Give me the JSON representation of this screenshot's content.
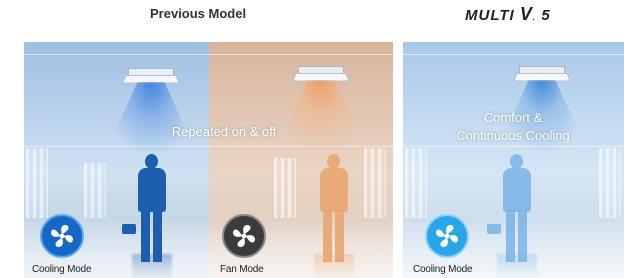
{
  "header": {
    "previous_label": "Previous Model",
    "brand_text": "MULTI",
    "brand_v": "V",
    "brand_num": "5"
  },
  "previous_panel": {
    "overlay_text": "Repeated on & off",
    "modes": [
      {
        "label": "Cooling Mode",
        "icon": "fan-icon",
        "color": "#1767c6"
      },
      {
        "label": "Fan Mode",
        "icon": "fan-icon",
        "color": "#3b3b3b"
      }
    ]
  },
  "new_panel": {
    "overlay_line1": "Comfort &",
    "overlay_line2": "Continuous Cooling",
    "mode": {
      "label": "Cooling Mode",
      "icon": "fan-icon",
      "color": "#2aa5e8"
    }
  },
  "colors": {
    "cool_tint": "#9fbfe4",
    "warm_tint": "#d7b49b",
    "person_cool": "#1d5fae",
    "person_warm": "#e8a56e"
  }
}
